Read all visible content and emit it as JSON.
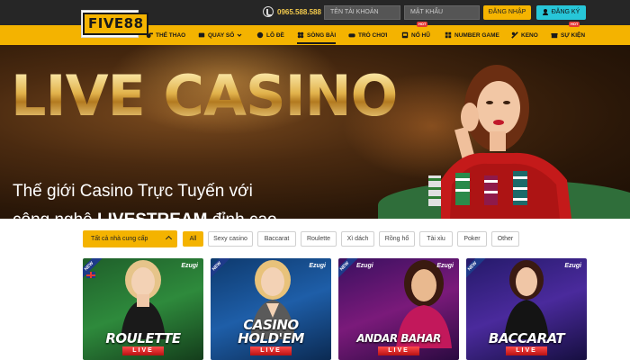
{
  "header": {
    "logo": "FIVE88",
    "phone": "0965.588.588",
    "username_placeholder": "TÊN TÀI KHOẢN",
    "password_placeholder": "MẬT KHẨU",
    "login_label": "ĐĂNG NHẬP",
    "register_label": "ĐĂNG KÝ"
  },
  "nav": {
    "items": [
      {
        "label": "THỂ THAO",
        "icon": "whistle-icon"
      },
      {
        "label": "QUAY SỐ",
        "icon": "lottery-icon",
        "dropdown": true
      },
      {
        "label": "LÔ ĐỀ",
        "icon": "ball-icon"
      },
      {
        "label": "SÒNG BÀI",
        "icon": "casino-icon",
        "active": true
      },
      {
        "label": "TRÒ CHƠI",
        "icon": "gamepad-icon"
      },
      {
        "label": "NỔ HŨ",
        "icon": "slot-icon",
        "badge": "HOT"
      },
      {
        "label": "NUMBER GAME",
        "icon": "number-icon"
      },
      {
        "label": "KENO",
        "icon": "keno-icon"
      },
      {
        "label": "SỰ KIỆN",
        "icon": "gift-icon",
        "badge": "HOT"
      }
    ]
  },
  "banner": {
    "headline": "LIVE CASINO",
    "tagline_line1": "Thế giới Casino Trực Tuyến với",
    "tagline_line2_prefix": "công nghệ ",
    "tagline_line2_bold": "LIVESTREAM",
    "tagline_line2_suffix": " đỉnh cao"
  },
  "filters": {
    "provider_label": "Tất cả nhà cung cấp",
    "chips": [
      "All",
      "Sexy casino",
      "Baccarat",
      "Roulette",
      "Xì dách",
      "Rồng hổ",
      "Tài xỉu",
      "Poker",
      "Other"
    ],
    "active_chip": "All"
  },
  "games": [
    {
      "title": "ROULETTE",
      "badge": "LIVE",
      "provider": "Ezugi",
      "new": "NEW",
      "color": "#2e7d32"
    },
    {
      "title": "CASINO HOLD'EM",
      "badge": "LIVE",
      "provider": "Ezugi",
      "new": "NEW",
      "color": "#1e5ea8"
    },
    {
      "title": "ANDAR BAHAR",
      "badge": "LIVE",
      "provider": "Ezugi",
      "new": "NEW",
      "color": "#6a1b9a"
    },
    {
      "title": "BACCARAT",
      "badge": "LIVE",
      "provider": "Ezugi",
      "new": "NEW",
      "color": "#3a2a8c"
    }
  ],
  "colors": {
    "accent": "#f4b300",
    "topbar": "#262626",
    "register": "#27c6d8",
    "live_red": "#d32f2f"
  }
}
